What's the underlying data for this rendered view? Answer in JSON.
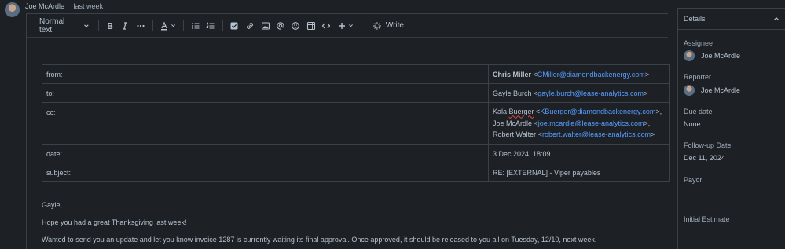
{
  "comment": {
    "author": "Joe McArdle",
    "timestamp": "last week"
  },
  "toolbar": {
    "text_style": "Normal text",
    "write_label": "Write",
    "icons": [
      "bold-icon",
      "italic-icon",
      "more-icon",
      "text-color-icon",
      "bullet-list-icon",
      "numbered-list-icon",
      "checkbox-icon",
      "link-icon",
      "image-icon",
      "mention-icon",
      "emoji-icon",
      "table-icon",
      "code-icon",
      "insert-plus-icon",
      "write-ai-icon"
    ]
  },
  "email": {
    "from_label": "from:",
    "from_name": "Chris Miller",
    "from_lt": " <",
    "from_email": "CMiller@diamondbackenergy.com",
    "from_gt": ">",
    "to_label": "to:",
    "to_name": "Gayle Burch <",
    "to_email": "gayle.burch@lease-analytics.com",
    "to_gt": ">",
    "cc_label": "cc:",
    "cc": [
      {
        "prefix": "Kala ",
        "name_flag": "Buerger",
        "lt": " <",
        "email": "KBuerger@diamondbackenergy.com",
        "suffix": ">,"
      },
      {
        "prefix": "Joe McArdle <",
        "email": "joe.mcardle@lease-analytics.com",
        "suffix": ">,"
      },
      {
        "prefix": "Robert Walter <",
        "email": "robert.walter@lease-analytics.com",
        "suffix": ">"
      }
    ],
    "date_label": "date:",
    "date_value": "3 Dec 2024, 18:09",
    "subject_label": "subject:",
    "subject_value": "RE: [EXTERNAL] - Viper payables"
  },
  "body": {
    "greeting": "Gayle,",
    "line1": "Hope you had a great Thanksgiving last week!",
    "line2": "Wanted to send you an update and let you know invoice 1287 is currently waiting its final approval. Once approved, it should be released to you all on Tuesday, 12/10, next week."
  },
  "details": {
    "title": "Details",
    "assignee_label": "Assignee",
    "assignee_value": "Joe McArdle",
    "reporter_label": "Reporter",
    "reporter_value": "Joe McArdle",
    "due_label": "Due date",
    "due_value": "None",
    "followup_label": "Follow-up Date",
    "followup_value": "Dec 11, 2024",
    "payor_label": "Payor",
    "initial_label": "Initial Estimate"
  },
  "colors": {
    "background": "#1d2125",
    "link": "#579dff",
    "border": "#3b4149",
    "text": "#b6c2cf"
  }
}
